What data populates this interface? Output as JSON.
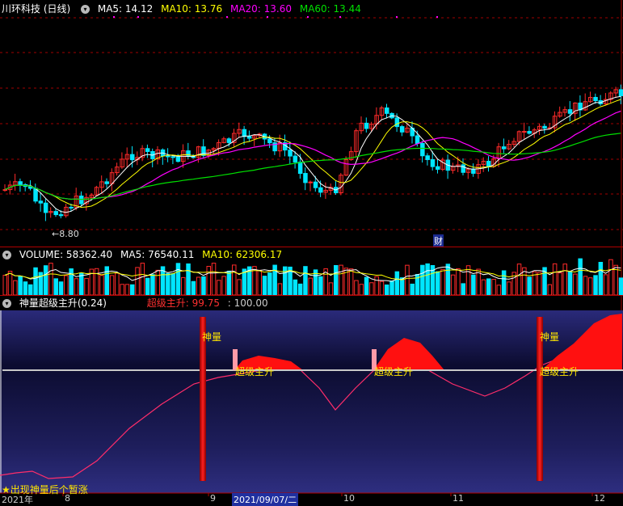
{
  "main_panel": {
    "title": "川环科技 (日线)",
    "ma_labels": [
      {
        "label": "MA5: 14.12",
        "color": "#ffffff"
      },
      {
        "label": "MA10: 13.76",
        "color": "#ffff00"
      },
      {
        "label": "MA20: 13.60",
        "color": "#ff00ff"
      },
      {
        "label": "MA60: 13.44",
        "color": "#00e000"
      }
    ],
    "low_marker": "8.80",
    "event_marker": "财"
  },
  "volume_panel": {
    "title": "VOLUME: 58362.40",
    "ma5": "MA5: 76540.11",
    "ma10": "MA10: 62306.17"
  },
  "indicator_panel": {
    "title": "神量超级主升(0.24)",
    "signal": "超级主升: 99.75",
    "value": ": 100.00",
    "volume_labels": [
      "神量",
      "神量"
    ],
    "rise_labels": [
      "超级主升",
      "超级主升",
      "超级主升"
    ],
    "footer_note": "★出现神量后个暂涨"
  },
  "time_axis": {
    "labels": [
      "2021年",
      "8",
      "9",
      "2021/09/07/二",
      "10",
      "11",
      "12"
    ],
    "cursor_date": "2021/09/07/二"
  },
  "colors": {
    "up": "#ff2a2a",
    "down": "#00e5ff",
    "grid": "#a00000",
    "ma5": "#ffffff",
    "ma10": "#ffff00",
    "ma20": "#ff00ff",
    "ma60": "#00e000"
  }
}
